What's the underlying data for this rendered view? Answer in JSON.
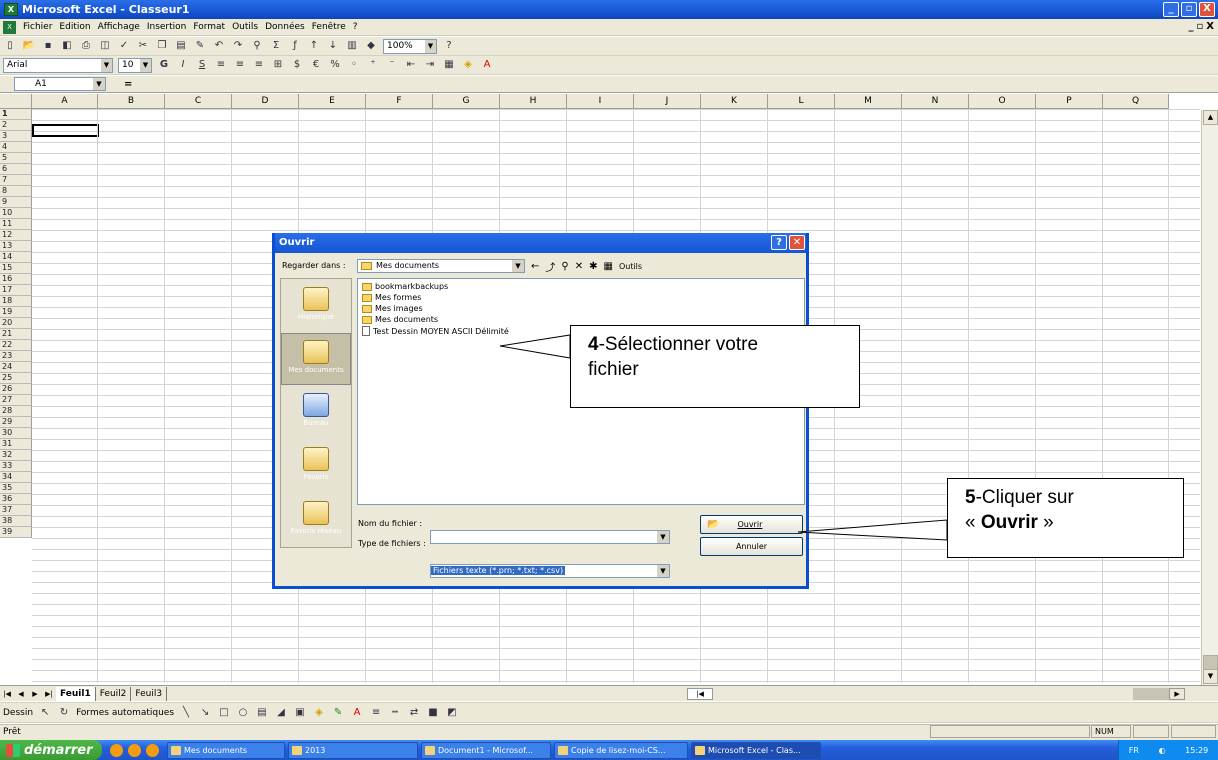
{
  "window": {
    "title": "Microsoft Excel - Classeur1",
    "controls": [
      "_",
      "▫",
      "X"
    ]
  },
  "menu": [
    "Fichier",
    "Edition",
    "Affichage",
    "Insertion",
    "Format",
    "Outils",
    "Données",
    "Fenêtre",
    "?"
  ],
  "menu_right": [
    "_",
    "▫",
    "X"
  ],
  "toolbar1": {
    "zoom": "100%"
  },
  "toolbar2": {
    "font": "Arial",
    "size": "10",
    "buttons": [
      "G",
      "I",
      "S"
    ]
  },
  "formula_bar": {
    "cell_ref": "A1",
    "equals": "="
  },
  "columns": [
    "A",
    "B",
    "C",
    "D",
    "E",
    "F",
    "G",
    "H",
    "I",
    "J",
    "K",
    "L",
    "M",
    "N",
    "O",
    "P",
    "Q"
  ],
  "rows": [
    "1",
    "2",
    "3",
    "4",
    "5",
    "6",
    "7",
    "8",
    "9",
    "10",
    "11",
    "12",
    "13",
    "14",
    "15",
    "16",
    "17",
    "18",
    "19",
    "20",
    "21",
    "22",
    "23",
    "24",
    "25",
    "26",
    "27",
    "28",
    "29",
    "30",
    "31",
    "32",
    "33",
    "34",
    "35",
    "36",
    "37",
    "38",
    "39"
  ],
  "sheet_tabs": [
    "Feuil1",
    "Feuil2",
    "Feuil3"
  ],
  "draw_toolbar": {
    "dessin": "Dessin",
    "formes": "Formes automatiques"
  },
  "status": {
    "text": "Prêt",
    "num": "NUM"
  },
  "taskbar": {
    "start": "démarrer",
    "items": [
      "Mes documents",
      "2013",
      "Document1 - Microsof...",
      "Copie de lisez-moi-CS...",
      "Microsoft Excel - Clas..."
    ],
    "lang": "FR",
    "clock": "15:29"
  },
  "dialog": {
    "title": "Ouvrir",
    "look_in_label": "Regarder dans :",
    "look_in_value": "Mes documents",
    "tools": "Outils",
    "places": [
      "Historique",
      "Mes documents",
      "Bureau",
      "Favoris",
      "Favoris réseau"
    ],
    "files": [
      "bookmarkbackups",
      "Mes formes",
      "Mes images",
      "Mes documents",
      "Test Dessin MOYEN ASCII Délimité"
    ],
    "filename_label": "Nom du fichier :",
    "filename_value": "",
    "filetype_label": "Type de fichiers :",
    "filetype_value": "Fichiers texte (*.prn; *.txt; *.csv)",
    "open_button": "Ouvrir",
    "cancel_button": "Annuler"
  },
  "callouts": {
    "step4_num": "4",
    "step4_text": "-Sélectionner votre",
    "step4_line2": "fichier",
    "step5_num": "5",
    "step5_text": "-Cliquer sur",
    "step5_line2_pre": "« ",
    "step5_line2_bold": "Ouvrir",
    "step5_line2_post": " »"
  }
}
